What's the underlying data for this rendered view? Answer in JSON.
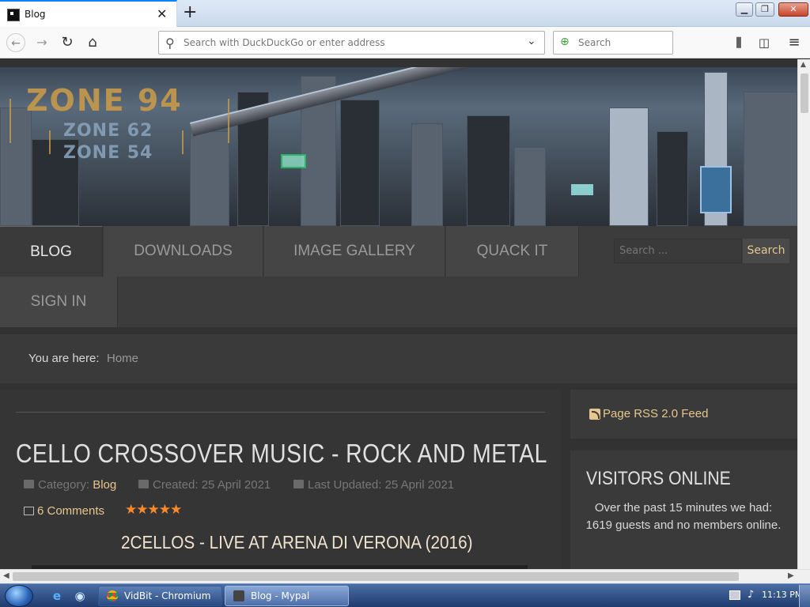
{
  "browser": {
    "tab_title": "Blog",
    "tab_close": "✕",
    "new_tab": "+",
    "url_placeholder": "Search with DuckDuckGo or enter address",
    "search_placeholder": "Search",
    "icons": [
      "back-icon",
      "forward-icon",
      "reload-icon",
      "home-icon",
      "library-icon",
      "sidebar-icon",
      "menu-icon"
    ]
  },
  "site": {
    "banner": {
      "logo_main": "ZONE 94",
      "logo_sub1": "ZONE 62",
      "logo_sub2": "ZONE 54"
    },
    "menu": [
      {
        "label": "BLOG",
        "active": true
      },
      {
        "label": "DOWNLOADS",
        "active": false
      },
      {
        "label": "IMAGE GALLERY",
        "active": false
      },
      {
        "label": "QUACK IT",
        "active": false
      },
      {
        "label": "SIGN IN",
        "active": false
      }
    ],
    "search": {
      "placeholder": "Search ...",
      "button": "Search"
    },
    "breadcrumb": {
      "label": "You are here:",
      "home": "Home"
    },
    "article": {
      "title": "CELLO CROSSOVER MUSIC - ROCK AND METAL",
      "category_label": "Category:",
      "category": "Blog",
      "created": "Created: 25 April 2021",
      "updated": "Last Updated: 25 April 2021",
      "comments": "6 Comments",
      "rating": 5,
      "rating_stars": "★★★★★",
      "video_title": "2CELLOS - LIVE AT ARENA DI VERONA (2016)"
    },
    "sidebar": {
      "rss": "Page RSS 2.0 Feed",
      "visitors_title": "VISITORS ONLINE",
      "visitors_text": "Over the past 15 minutes we had: 1619 guests and no members online."
    },
    "colors": {
      "accent": "#e6c78e",
      "star": "#ff8a2a",
      "background": "#323232"
    }
  },
  "taskbar": {
    "tasks": [
      {
        "label": "VidBit - Chromium",
        "active": false
      },
      {
        "label": "Blog - Mypal",
        "active": true
      }
    ],
    "clock": "11:13 PM"
  }
}
